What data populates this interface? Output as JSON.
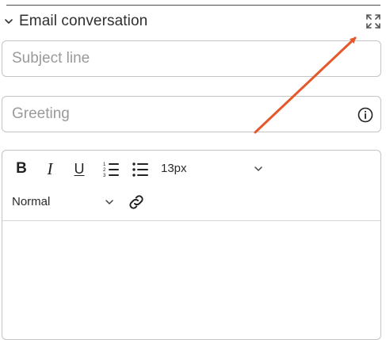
{
  "section": {
    "title": "Email conversation",
    "collapse_icon": "chevron-down-icon",
    "expand_icon": "expand-icon"
  },
  "subject": {
    "placeholder": "Subject line",
    "value": ""
  },
  "greeting": {
    "placeholder": "Greeting",
    "value": "",
    "info_icon": "info-icon"
  },
  "editor": {
    "toolbar": {
      "bold_label": "B",
      "italic_label": "I",
      "underline_label": "U",
      "ordered_list_icon": "ordered-list-icon",
      "bullet_list_icon": "bullet-list-icon",
      "font_size": "13px",
      "paragraph_style": "Normal",
      "link_icon": "link-icon"
    },
    "content": ""
  },
  "colors": {
    "annotation_arrow": "#e4582b",
    "border": "#c4c4c4",
    "text": "#2b2b2b",
    "placeholder": "#9a9a9a"
  }
}
